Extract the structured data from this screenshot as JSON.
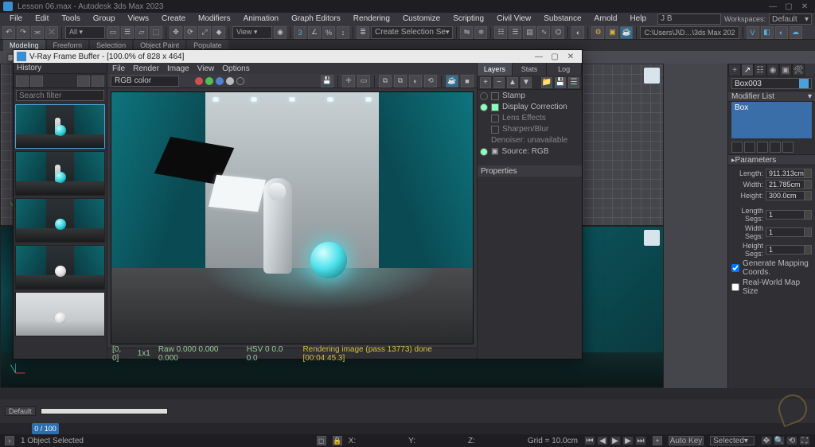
{
  "titlebar": {
    "text": "Lesson 06.max - Autodesk 3ds Max 2023"
  },
  "menu": {
    "items": [
      "File",
      "Edit",
      "Tools",
      "Group",
      "Views",
      "Create",
      "Modifiers",
      "Animation",
      "Graph Editors",
      "Rendering",
      "Customize",
      "Scripting",
      "Civil View",
      "Substance",
      "Arnold",
      "Help"
    ],
    "user": "J B",
    "workspace_label": "Workspaces:",
    "workspace_value": "Default"
  },
  "main_toolbar": {
    "selection_set_placeholder": "Create Selection Se",
    "path_field": "C:\\Users\\J\\D…\\3ds Max 202"
  },
  "ribbon": {
    "tabs": [
      "Modeling",
      "Freeform",
      "Selection",
      "Object Paint",
      "Populate"
    ],
    "active": "Modeling"
  },
  "vfb": {
    "title": "V-Ray Frame Buffer - [100.0% of 828 x 464]",
    "history_label": "History",
    "search_placeholder": "Search filter",
    "menu": [
      "File",
      "Render",
      "Image",
      "View",
      "Options"
    ],
    "channel": "RGB color",
    "status_coords": "[0, 0]",
    "status_zoom": "1x1",
    "status_raw": "Raw   0.000  0.000  0.000",
    "status_hsv": "HSV   0    0.0    0.0",
    "status_msg": "Rendering image (pass 13773)  done [00:04:45.3]",
    "side_tabs": [
      "Layers",
      "Stats",
      "Log"
    ],
    "layers": {
      "stamp": "Stamp",
      "display_correction": "Display Correction",
      "lens_effects": "Lens Effects",
      "sharpen_blur": "Sharpen/Blur",
      "denoiser": "Denoiser: unavailable",
      "source": "Source: RGB"
    },
    "properties_label": "Properties"
  },
  "cmd": {
    "object_name": "Box003",
    "modifier_list_label": "Modifier List",
    "stack_item": "Box",
    "parameters_label": "Parameters",
    "params": {
      "length_label": "Length:",
      "length_val": "911.313cm",
      "width_label": "Width:",
      "width_val": "21.785cm",
      "height_label": "Height:",
      "height_val": "300.0cm",
      "lsegs_label": "Length Segs:",
      "lsegs_val": "1",
      "wsegs_label": "Width Segs:",
      "wsegs_val": "1",
      "hsegs_label": "Height Segs:",
      "hsegs_val": "1",
      "gen_map": "Generate Mapping Coords.",
      "real_world": "Real-World Map Size"
    }
  },
  "timeline": {
    "layer_drop": "Default",
    "current_frame": "0 / 100"
  },
  "status": {
    "selection": "1 Object Selected",
    "grid": "Grid = 10.0cm",
    "autokey": "Auto Key",
    "setkey_mode": "Selected"
  }
}
